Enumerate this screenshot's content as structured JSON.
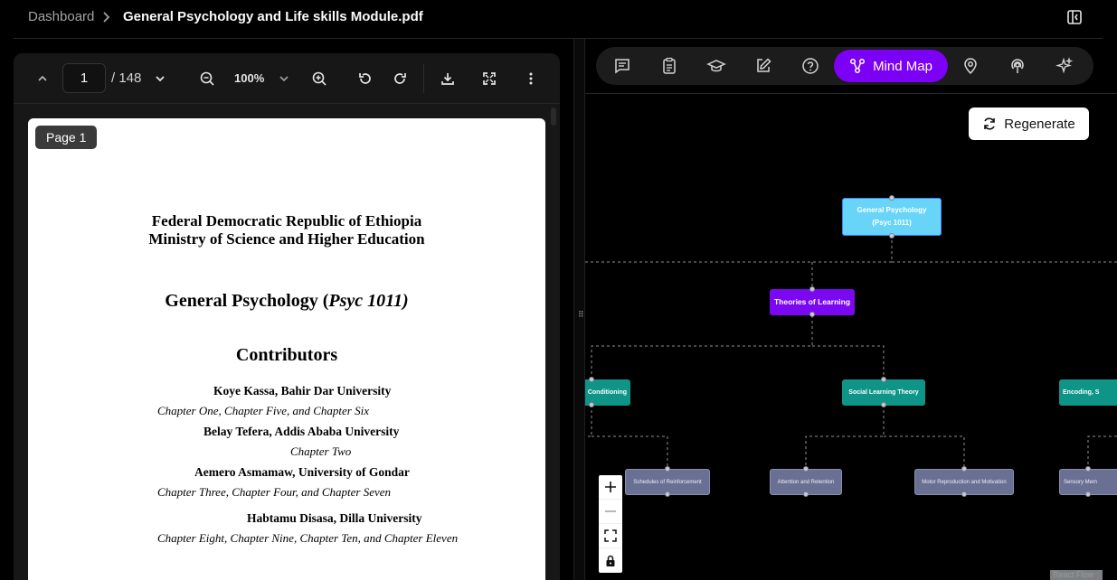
{
  "breadcrumb": {
    "root": "Dashboard",
    "current": "General Psychology and Life skills Module.pdf"
  },
  "pdf_toolbar": {
    "page_value": "1",
    "page_total": "/ 148",
    "zoom": "100%"
  },
  "pdf_page": {
    "badge": "Page 1",
    "line1": "Federal Democratic Republic of Ethiopia",
    "line2": "Ministry of Science and Higher Education",
    "title_main": "General Psychology (",
    "title_code": "Psyc 1011)",
    "contributors_heading": "Contributors",
    "contributors": [
      {
        "name": "Koye Kassa, Bahir Dar University",
        "chapters": "Chapter One, Chapter Five, and Chapter Six"
      },
      {
        "name": "Belay Tefera, Addis Ababa University",
        "chapters": "Chapter Two"
      },
      {
        "name": "Aemero Asmamaw, University of Gondar",
        "chapters": "Chapter Three, Chapter Four, and Chapter Seven"
      },
      {
        "name": "Habtamu Disasa, Dilla University",
        "chapters": "Chapter Eight, Chapter Nine, Chapter Ten, and Chapter Eleven"
      }
    ]
  },
  "tabs": {
    "active_label": "Mind Map"
  },
  "regenerate_label": "Regenerate",
  "mindmap": {
    "root": [
      "General Psychology",
      "(Psyc 1011)"
    ],
    "level1": "Theories of Learning",
    "level2": [
      "Conditioning",
      "Social Learning Theory",
      "Encoding, S"
    ],
    "level3": [
      "Schedules of Reinforcement",
      "Attention and Retention",
      "Motor Reproduction and Motivation",
      "Sensory Mem"
    ]
  },
  "attribution": "React Flow",
  "colors": {
    "accent": "#7c00f5",
    "root_node": "#67d4f8",
    "level1_node": "#7b08f0",
    "level2_node": "#0f9488",
    "level3_node": "#6a6f94"
  }
}
